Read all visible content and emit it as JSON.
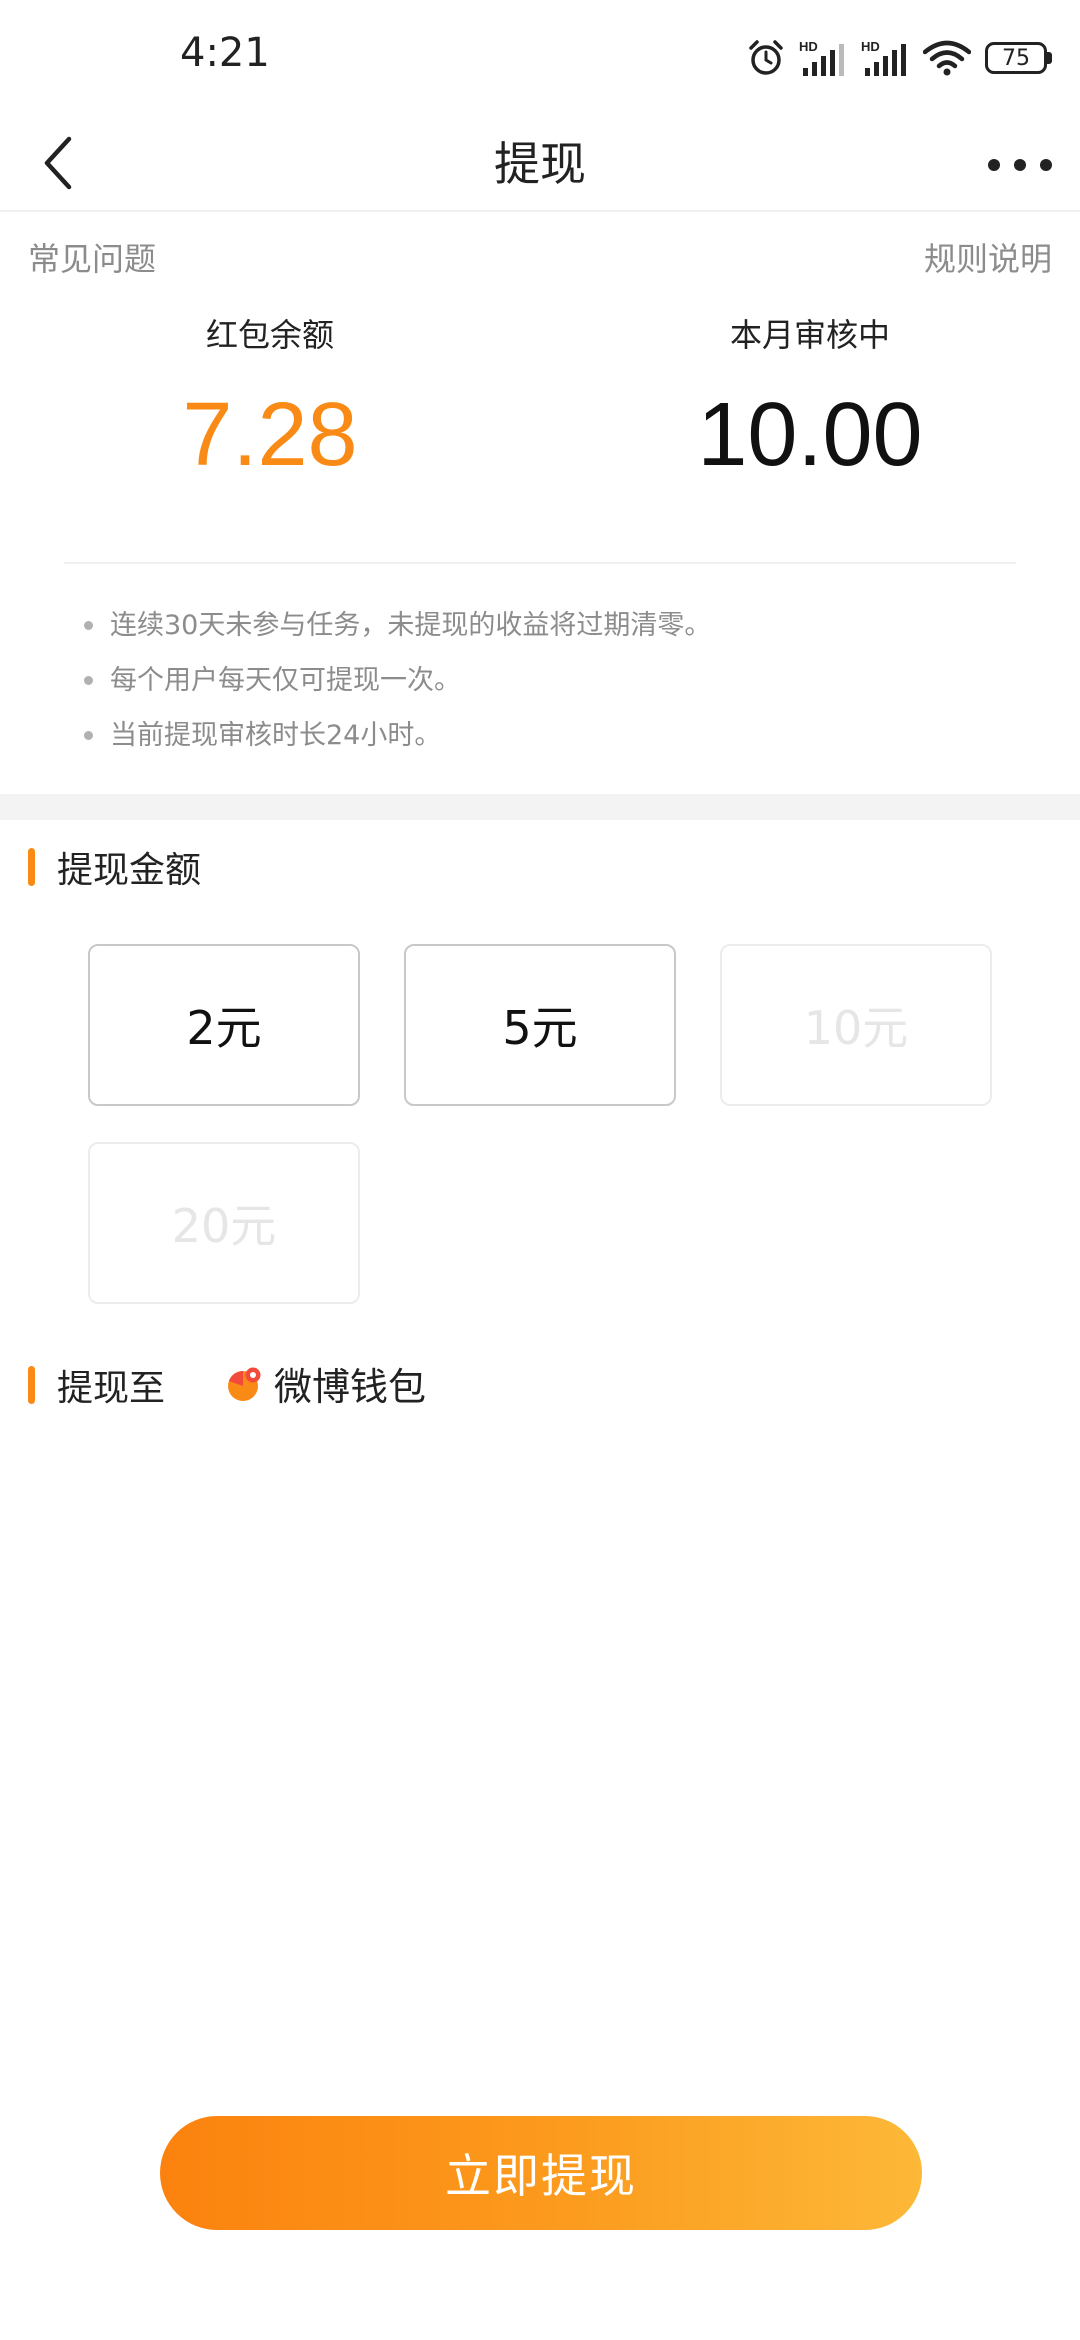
{
  "status_bar": {
    "time": "4:21",
    "battery": "75",
    "icons": [
      "alarm-icon",
      "signal-hd-icon",
      "signal-hd-icon",
      "wifi-icon",
      "battery-icon"
    ],
    "signal_label": "HD"
  },
  "nav": {
    "title": "提现",
    "back_icon": "chevron-left-icon",
    "more_icon": "more-dots-icon"
  },
  "links": {
    "faq": "常见问题",
    "rules": "规则说明"
  },
  "balance": {
    "red_packet_label": "红包余额",
    "red_packet_value": "7.28",
    "reviewing_label": "本月审核中",
    "reviewing_value": "10.00"
  },
  "notes": [
    "连续30天未参与任务，未提现的收益将过期清零。",
    "每个用户每天仅可提现一次。",
    "当前提现审核时长24小时。"
  ],
  "amount_section": {
    "title": "提现金额",
    "options": [
      {
        "label": "2元",
        "enabled": true
      },
      {
        "label": "5元",
        "enabled": true
      },
      {
        "label": "10元",
        "enabled": false
      },
      {
        "label": "20元",
        "enabled": false
      }
    ]
  },
  "destination_section": {
    "title": "提现至",
    "wallet_name": "微博钱包",
    "wallet_icon": "weibo-wallet-icon"
  },
  "submit_label": "立即提现",
  "colors": {
    "accent": "#f98a16",
    "button_gradient_start": "#fb820e",
    "button_gradient_end": "#fdb838",
    "muted_text": "#8c8c8c"
  }
}
